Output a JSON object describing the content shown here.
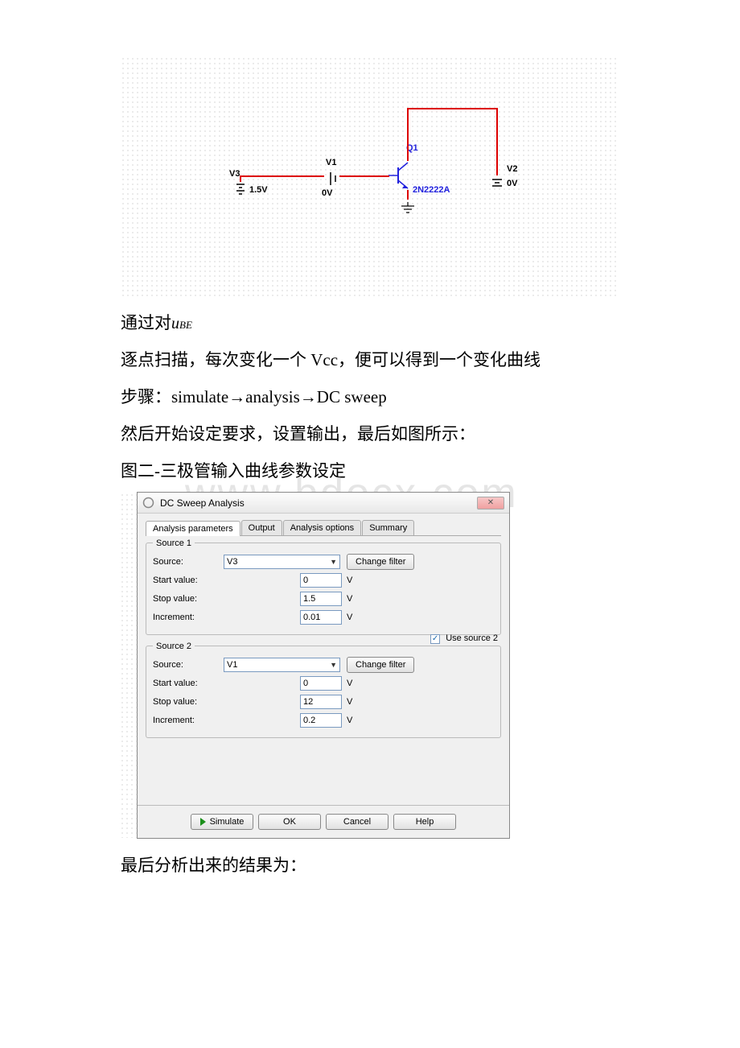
{
  "circuit": {
    "v3_name": "V3",
    "v3_val": "1.5V",
    "v1_name": "V1",
    "v1_val": "0V",
    "v2_name": "V2",
    "v2_val": "0V",
    "q1_name": "Q1",
    "q1_part": "2N2222A"
  },
  "text": {
    "line1a": "通过对",
    "line1b_u": "u",
    "line1b_be": "BE",
    "line2": "逐点扫描，每次变化一个 Vcc，便可以得到一个变化曲线",
    "line3": "步骤：simulate→analysis→DC sweep",
    "line4": "然后开始设定要求，设置输出，最后如图所示：",
    "line5": "图二-三极管输入曲线参数设定",
    "watermark": "www.bdocx.com",
    "line6": "最后分析出来的结果为："
  },
  "dialog": {
    "title": "DC Sweep Analysis",
    "close": "✕",
    "tabs": {
      "params": "Analysis parameters",
      "output": "Output",
      "options": "Analysis options",
      "summary": "Summary"
    },
    "src1": {
      "legend": "Source 1",
      "source_label": "Source:",
      "source_val": "V3",
      "change_filter": "Change filter",
      "start_label": "Start value:",
      "start_val": "0",
      "stop_label": "Stop value:",
      "stop_val": "1.5",
      "inc_label": "Increment:",
      "inc_val": "0.01",
      "unit": "V"
    },
    "use_src2_label": "Use source 2",
    "src2": {
      "legend": "Source 2",
      "source_label": "Source:",
      "source_val": "V1",
      "change_filter": "Change filter",
      "start_label": "Start value:",
      "start_val": "0",
      "stop_label": "Stop value:",
      "stop_val": "12",
      "inc_label": "Increment:",
      "inc_val": "0.2",
      "unit": "V"
    },
    "buttons": {
      "simulate": "Simulate",
      "ok": "OK",
      "cancel": "Cancel",
      "help": "Help"
    }
  }
}
